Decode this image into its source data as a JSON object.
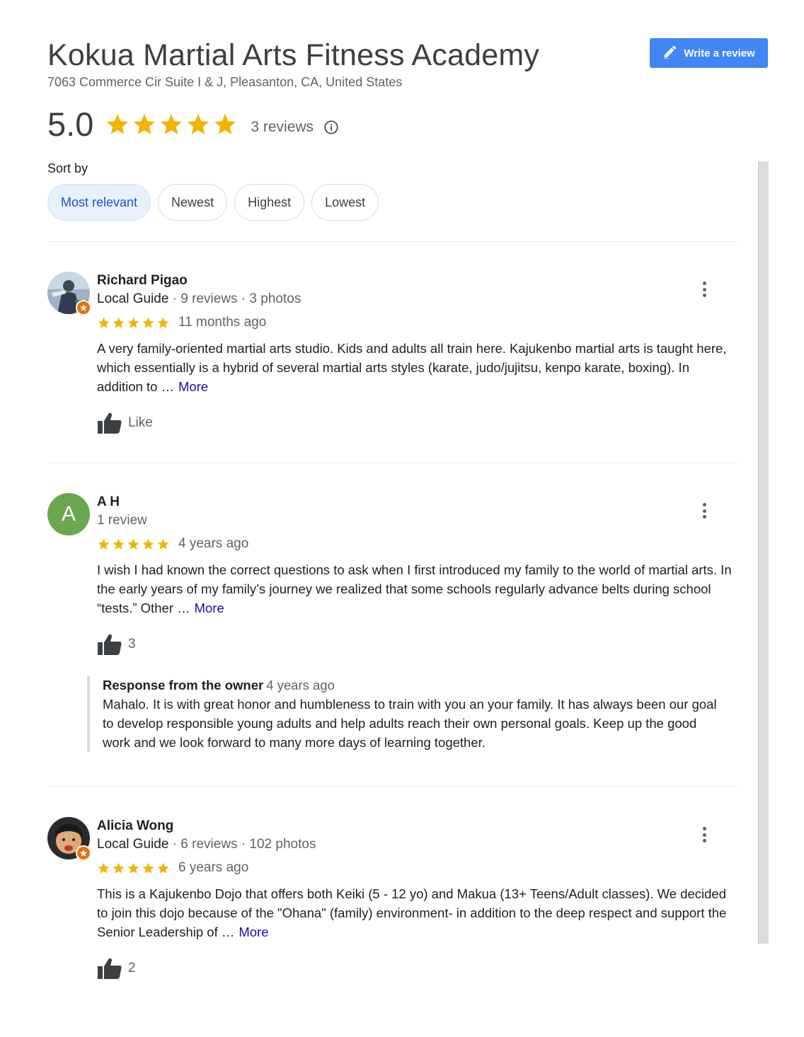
{
  "business": {
    "name": "Kokua Martial Arts Fitness Academy",
    "address": "7063 Commerce Cir Suite I & J, Pleasanton, CA, United States",
    "rating": "5.0",
    "rating_value": 5,
    "reviews_count": "3 reviews",
    "write_review_label": "Write a review"
  },
  "sort": {
    "label": "Sort by",
    "options": [
      "Most relevant",
      "Newest",
      "Highest",
      "Lowest"
    ],
    "selected": "Most relevant"
  },
  "reviews": [
    {
      "name": "Richard Pigao",
      "guide": "Local Guide",
      "meta": " · 9 reviews · 3 photos",
      "stars": 5,
      "time": "11 months ago",
      "text": "A very family-oriented martial arts studio. Kids and adults all train here. Kajukenbo martial arts is taught here, which essentially is a hybrid of several martial arts styles (karate, judo/jujitsu, kenpo karate, boxing). In addition to …",
      "more": "More",
      "likes": "Like"
    },
    {
      "name": "A H",
      "avatar_letter": "A",
      "meta": "1 review",
      "stars": 5,
      "time": "4 years ago",
      "text": "I wish I had known the correct questions to ask when I first introduced my family to the world of martial arts. In the early years of my family’s journey we realized that some schools regularly advance belts during school “tests.” Other …",
      "more": "More",
      "likes": "3",
      "owner_response": {
        "label": "Response from the owner",
        "time": "4 years ago",
        "text": "Mahalo. It is with great honor and humbleness to train with you an your family. It has always been our goal to develop responsible young adults and help adults reach their own personal goals. Keep up the good work and we look forward to many more days of learning together."
      }
    },
    {
      "name": "Alicia Wong",
      "guide": "Local Guide",
      "meta": " · 6 reviews · 102 photos",
      "stars": 5,
      "time": "6 years ago",
      "text": "This is a Kajukenbo Dojo that offers both Keiki (5 - 12 yo) and Makua (13+ Teens/Adult classes).  We decided to join this dojo because of the \"Ohana\" (family) environment- in addition to the deep respect and support the Senior Leadership of …",
      "more": "More",
      "likes": "2"
    }
  ],
  "colors": {
    "star": "#f4b400",
    "accent": "#4285f4",
    "link": "#1a0dab",
    "chip_active_bg": "#e8f0fe",
    "avatar_green": "#6aa84f",
    "local_guide_badge": "#e8710a"
  },
  "icons": [
    "pencil-icon",
    "star-icon",
    "info-icon",
    "thumbs-up-icon",
    "more-vert-icon",
    "local-guide-badge-icon"
  ]
}
